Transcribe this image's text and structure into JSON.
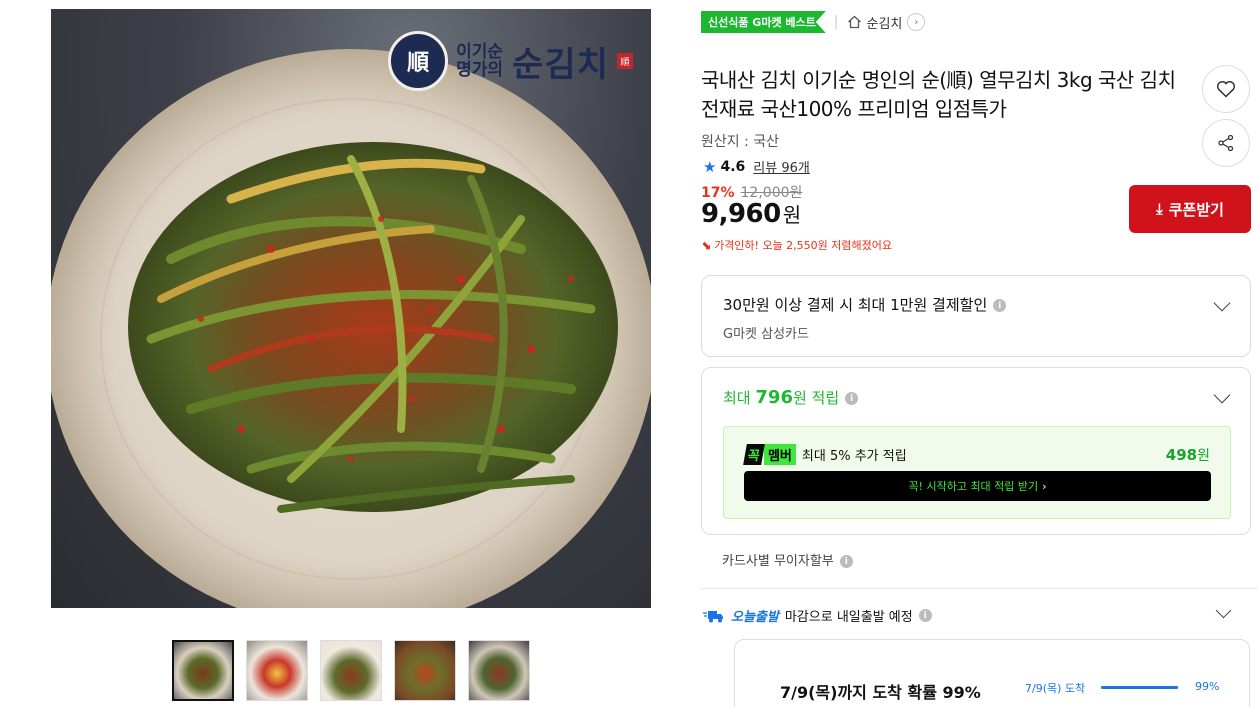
{
  "brand": {
    "seal": "順",
    "subtitle": "이기순 명가의",
    "name": "순김치",
    "stamp": "順"
  },
  "badges": {
    "best": "신선식품 G마켓 베스트",
    "category": "순김치"
  },
  "product": {
    "title": "국내산 김치 이기순 명인의 순(順) 열무김치 3kg 국산 김치 전재료 국산100% 프리미엄 입점특가",
    "origin": "원산지 : 국산",
    "rating": "4.6",
    "review_label": "리뷰 96개"
  },
  "price": {
    "discount": "17%",
    "original": "12,000원",
    "current": "9,960",
    "currency": "원",
    "drop_notice": "가격인하! 오늘 2,550원 저렴해졌어요"
  },
  "coupon": {
    "label": "쿠폰받기"
  },
  "payment_benefit": {
    "title": "30만원 이상 결제 시 최대 1만원 결제할인",
    "card": "G마켓 삼성카드"
  },
  "points": {
    "prefix": "최대",
    "amount": "796",
    "suffix": "원 적립",
    "member_brand_1": "꼭",
    "member_brand_2": "멤버",
    "member_desc": "최대 5% 추가 적립",
    "member_amount": "498",
    "member_unit": "원",
    "member_cta": "꼭! 시작하고 최대 적립 받기"
  },
  "installment": "카드사별 무이자할부",
  "delivery": {
    "tag": "오늘출발",
    "text": "마감으로 내일출발 예정",
    "arrival_main": "7/9(목)까지 도착 확률 99%",
    "arrival_label": "7/9(목) 도착",
    "arrival_pct": "99%",
    "arrival_fraction": 0.99
  },
  "colors": {
    "accent_red": "#d0131a",
    "accent_green": "#1bb830",
    "accent_blue": "#1a73e8"
  },
  "icons": {
    "wish": "heart-icon",
    "share": "share-icon",
    "home": "home-icon",
    "star": "star-icon",
    "truck": "truck-icon",
    "download": "download-icon"
  }
}
